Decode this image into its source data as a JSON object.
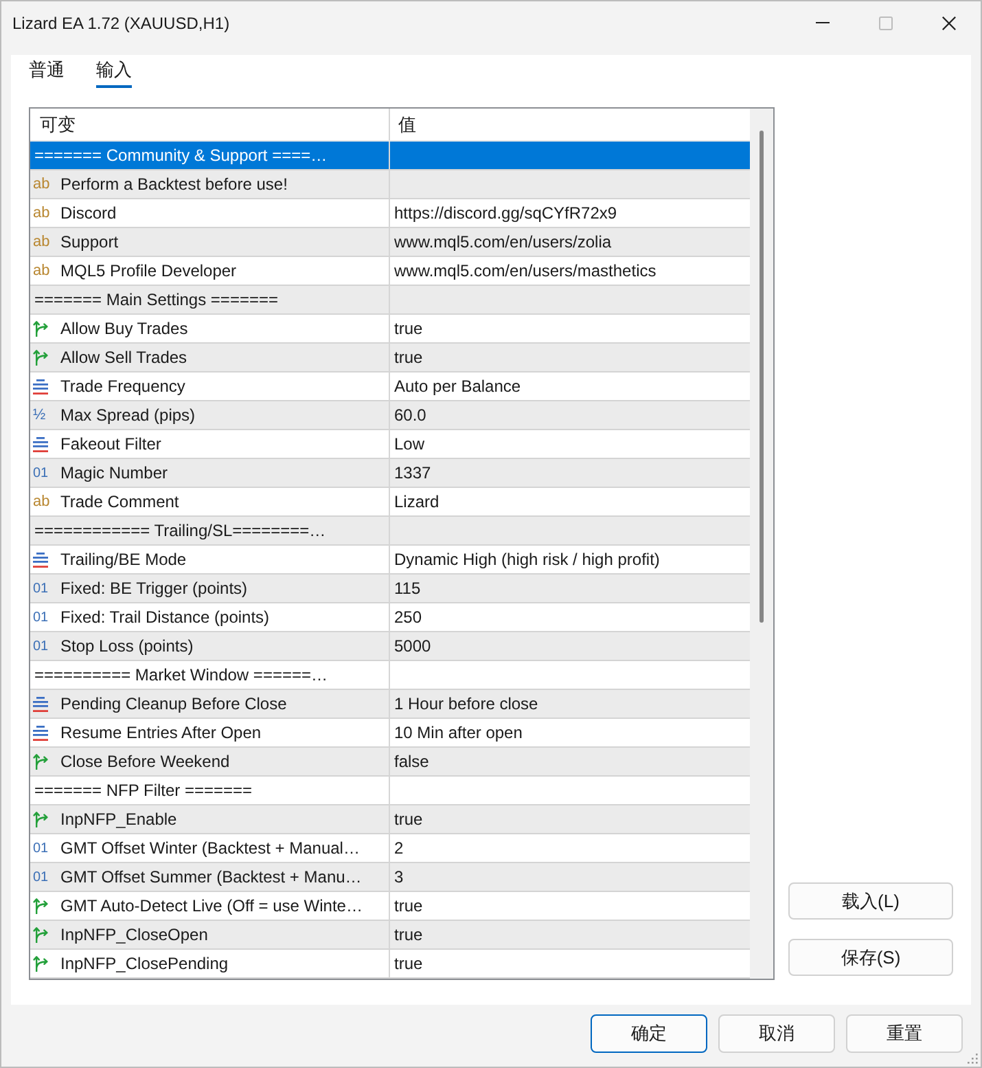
{
  "window": {
    "title": "Lizard EA 1.72 (XAUUSD,H1)",
    "controls": [
      {
        "kind": "minimize",
        "disabled": false
      },
      {
        "kind": "maximize",
        "disabled": true
      },
      {
        "kind": "close",
        "disabled": false
      }
    ]
  },
  "tabs": [
    {
      "label": "普通",
      "selected": false
    },
    {
      "label": "输入",
      "selected": true
    }
  ],
  "table": {
    "columns": [
      "可变",
      "值"
    ],
    "rows": [
      {
        "kind": "section",
        "name": "======= Community & Support ====…",
        "selected": true
      },
      {
        "kind": "string",
        "glyph": "ab",
        "name": "Perform a Backtest before use!",
        "selected": false
      },
      {
        "kind": "string",
        "glyph": "ab",
        "name": "Discord",
        "value": "https://discord.gg/sqCYfR72x9",
        "selected": false
      },
      {
        "kind": "string",
        "glyph": "ab",
        "name": "Support",
        "value": "www.mql5.com/en/users/zolia",
        "selected": false
      },
      {
        "kind": "string",
        "glyph": "ab",
        "name": "MQL5 Profile Developer",
        "value": "www.mql5.com/en/users/masthetics",
        "selected": false
      },
      {
        "kind": "section",
        "name": "======= Main Settings =======",
        "selected": false
      },
      {
        "kind": "bool",
        "name": "Allow Buy Trades",
        "value": "true",
        "selected": false
      },
      {
        "kind": "bool",
        "name": "Allow Sell Trades",
        "value": "true",
        "selected": false
      },
      {
        "kind": "enum",
        "name": "Trade Frequency",
        "value": "Auto per Balance",
        "selected": false
      },
      {
        "kind": "double",
        "glyph": "½",
        "name": "Max Spread (pips)",
        "value": "60.0",
        "selected": false
      },
      {
        "kind": "enum",
        "name": "Fakeout Filter",
        "value": "Low",
        "selected": false
      },
      {
        "kind": "int",
        "glyph": "01",
        "name": "Magic Number",
        "value": "1337",
        "selected": false
      },
      {
        "kind": "string",
        "glyph": "ab",
        "name": "Trade Comment",
        "value": "Lizard",
        "selected": false
      },
      {
        "kind": "section",
        "name": "============ Trailing/SL========…",
        "selected": false
      },
      {
        "kind": "enum",
        "name": "Trailing/BE Mode",
        "value": "Dynamic High (high risk / high profit)",
        "selected": false
      },
      {
        "kind": "int",
        "glyph": "01",
        "name": "Fixed: BE Trigger (points)",
        "value": "115",
        "selected": false
      },
      {
        "kind": "int",
        "glyph": "01",
        "name": "Fixed: Trail Distance (points)",
        "value": "250",
        "selected": false
      },
      {
        "kind": "int",
        "glyph": "01",
        "name": "Stop Loss (points)",
        "value": "5000",
        "selected": false
      },
      {
        "kind": "section",
        "name": "========== Market Window ======…",
        "selected": false
      },
      {
        "kind": "enum",
        "name": "Pending Cleanup Before Close",
        "value": "1 Hour before close",
        "selected": false
      },
      {
        "kind": "enum",
        "name": "Resume Entries After Open",
        "value": "10 Min after open",
        "selected": false
      },
      {
        "kind": "bool",
        "name": "Close Before Weekend",
        "value": "false",
        "selected": false
      },
      {
        "kind": "section",
        "name": "======= NFP Filter =======",
        "selected": false
      },
      {
        "kind": "bool",
        "name": "InpNFP_Enable",
        "value": "true",
        "selected": false
      },
      {
        "kind": "int",
        "glyph": "01",
        "name": "GMT Offset Winter (Backtest + Manual…",
        "value": "2",
        "selected": false
      },
      {
        "kind": "int",
        "glyph": "01",
        "name": "GMT Offset Summer (Backtest + Manu…",
        "value": "3",
        "selected": false
      },
      {
        "kind": "bool",
        "name": "GMT Auto-Detect Live (Off = use Winte…",
        "value": "true",
        "selected": false
      },
      {
        "kind": "bool",
        "name": "InpNFP_CloseOpen",
        "value": "true",
        "selected": false
      },
      {
        "kind": "bool",
        "name": "InpNFP_ClosePending",
        "value": "true",
        "selected": false
      }
    ]
  },
  "side_buttons": [
    "载入(L)",
    "保存(S)"
  ],
  "buttons": [
    {
      "label": "确定",
      "default": true
    },
    {
      "label": "取消",
      "default": false
    },
    {
      "label": "重置",
      "default": false
    }
  ]
}
